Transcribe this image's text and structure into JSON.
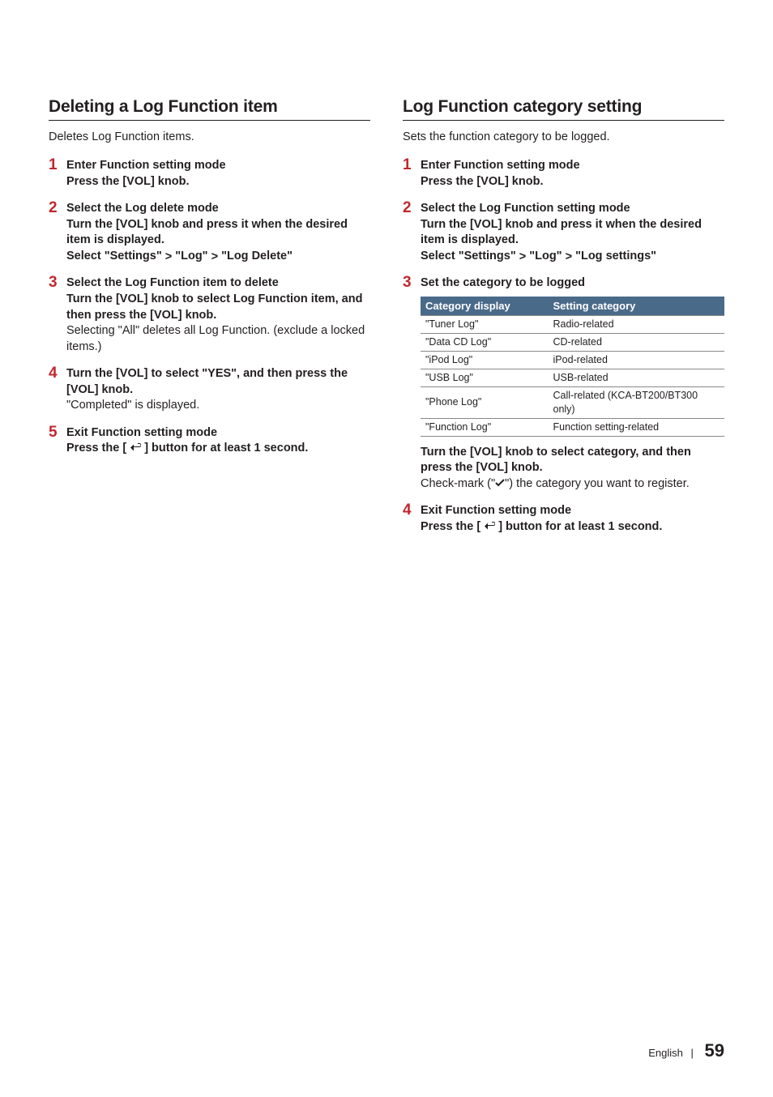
{
  "left": {
    "title": "Deleting a Log Function item",
    "intro": "Deletes Log Function items.",
    "steps": [
      {
        "num": "1",
        "bold1": "Enter Function setting mode",
        "bold2": "Press the [VOL] knob."
      },
      {
        "num": "2",
        "bold1": "Select the Log delete mode",
        "bold2": "Turn the [VOL] knob and press it when the desired item is displayed.",
        "bold3_pre": "Select \"Settings\" ",
        "bold3_mid": " \"Log\" ",
        "bold3_post": " \"Log Delete\""
      },
      {
        "num": "3",
        "bold1": "Select the Log Function item to delete",
        "bold2": "Turn the [VOL] knob to select Log Function item, and then press the [VOL] knob.",
        "plain": "Selecting \"All\" deletes all Log Function. (exclude a locked items.)"
      },
      {
        "num": "4",
        "bold1": "Turn the [VOL] to select \"YES\", and then press the [VOL] knob.",
        "plain": "\"Completed\" is displayed."
      },
      {
        "num": "5",
        "bold1": "Exit Function setting mode",
        "bold2_pre": "Press the [ ",
        "bold2_post": " ] button for at least 1 second."
      }
    ]
  },
  "right": {
    "title": "Log Function category setting",
    "intro": "Sets the function category to be logged.",
    "steps_a": [
      {
        "num": "1",
        "bold1": "Enter Function setting mode",
        "bold2": "Press the [VOL] knob."
      },
      {
        "num": "2",
        "bold1": "Select the Log Function setting mode",
        "bold2": "Turn the [VOL] knob and press it when the desired item is displayed.",
        "bold3_pre": "Select \"Settings\" ",
        "bold3_mid": " \"Log\" ",
        "bold3_post": " \"Log settings\""
      },
      {
        "num": "3",
        "bold1": "Set the category to be logged"
      }
    ],
    "table": {
      "headers": [
        "Category display",
        "Setting category"
      ],
      "rows": [
        [
          "\"Tuner Log\"",
          "Radio-related"
        ],
        [
          "\"Data CD Log\"",
          "CD-related"
        ],
        [
          "\"iPod Log\"",
          "iPod-related"
        ],
        [
          "\"USB Log\"",
          "USB-related"
        ],
        [
          "\"Phone Log\"",
          "Call-related (KCA-BT200/BT300 only)"
        ],
        [
          "\"Function Log\"",
          "Function setting-related"
        ]
      ]
    },
    "after_table": {
      "bold": "Turn the [VOL] knob to select category, and then press the [VOL] knob.",
      "plain_pre": "Check-mark (\"",
      "plain_post": "\") the category you want to register."
    },
    "steps_b": [
      {
        "num": "4",
        "bold1": "Exit Function setting mode",
        "bold2_pre": "Press the [ ",
        "bold2_post": " ] button for at least 1 second."
      }
    ]
  },
  "footer": {
    "lang": "English",
    "sep": "|",
    "page": "59"
  }
}
